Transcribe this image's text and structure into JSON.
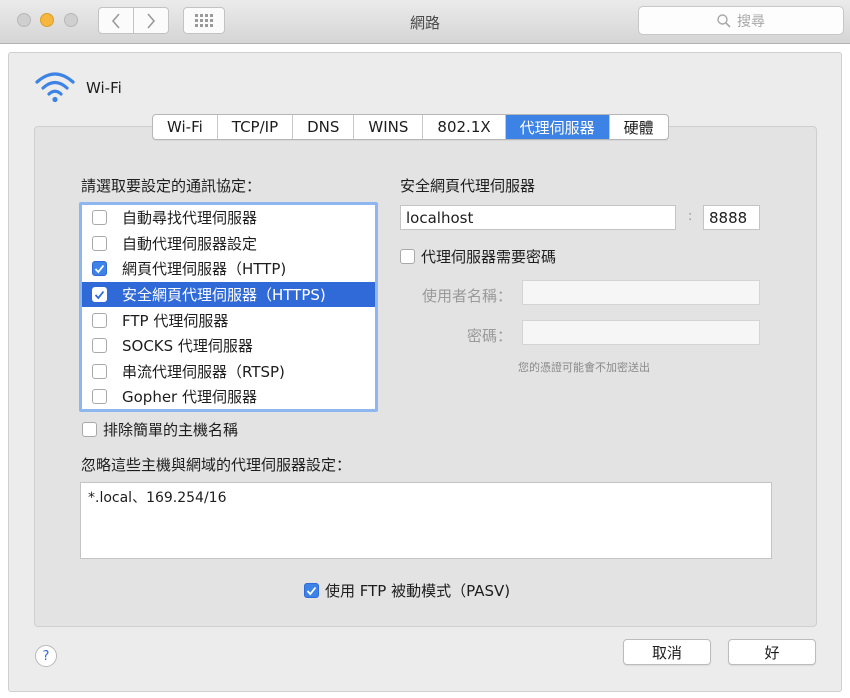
{
  "window": {
    "title": "網路"
  },
  "toolbar": {
    "search_placeholder": "搜尋"
  },
  "service": {
    "name": "Wi-Fi"
  },
  "tabs": [
    {
      "label": "Wi-Fi"
    },
    {
      "label": "TCP/IP"
    },
    {
      "label": "DNS"
    },
    {
      "label": "WINS"
    },
    {
      "label": "802.1X"
    },
    {
      "label": "代理伺服器"
    },
    {
      "label": "硬體"
    }
  ],
  "active_tab": "代理伺服器",
  "protocols": {
    "heading": "請選取要設定的通訊協定：",
    "items": [
      {
        "label": "自動尋找代理伺服器",
        "checked": false
      },
      {
        "label": "自動代理伺服器設定",
        "checked": false
      },
      {
        "label": "網頁代理伺服器（HTTP)",
        "checked": true
      },
      {
        "label": "安全網頁代理伺服器（HTTPS)",
        "checked": true
      },
      {
        "label": "FTP 代理伺服器",
        "checked": false
      },
      {
        "label": "SOCKS 代理伺服器",
        "checked": false
      },
      {
        "label": "串流代理伺服器（RTSP)",
        "checked": false
      },
      {
        "label": "Gopher 代理伺服器",
        "checked": false
      }
    ]
  },
  "exclude_simple": {
    "label": "排除簡單的主機名稱",
    "checked": false
  },
  "server": {
    "heading": "安全網頁代理伺服器",
    "host": "localhost",
    "port": "8888",
    "requires_password_label": "代理伺服器需要密碼",
    "username_label": "使用者名稱：",
    "password_label": "密碼：",
    "note": "您的憑證可能會不加密送出"
  },
  "bypass": {
    "label": "忽略這些主機與網域的代理伺服器設定：",
    "value": "*.local、169.254/16"
  },
  "passive_ftp": {
    "label": "使用 FTP 被動模式（PASV)",
    "checked": true
  },
  "buttons": {
    "help": "?",
    "cancel": "取消",
    "ok": "好"
  },
  "colors": {
    "accent": "#3d83e6",
    "selection": "#2f6ad8"
  }
}
